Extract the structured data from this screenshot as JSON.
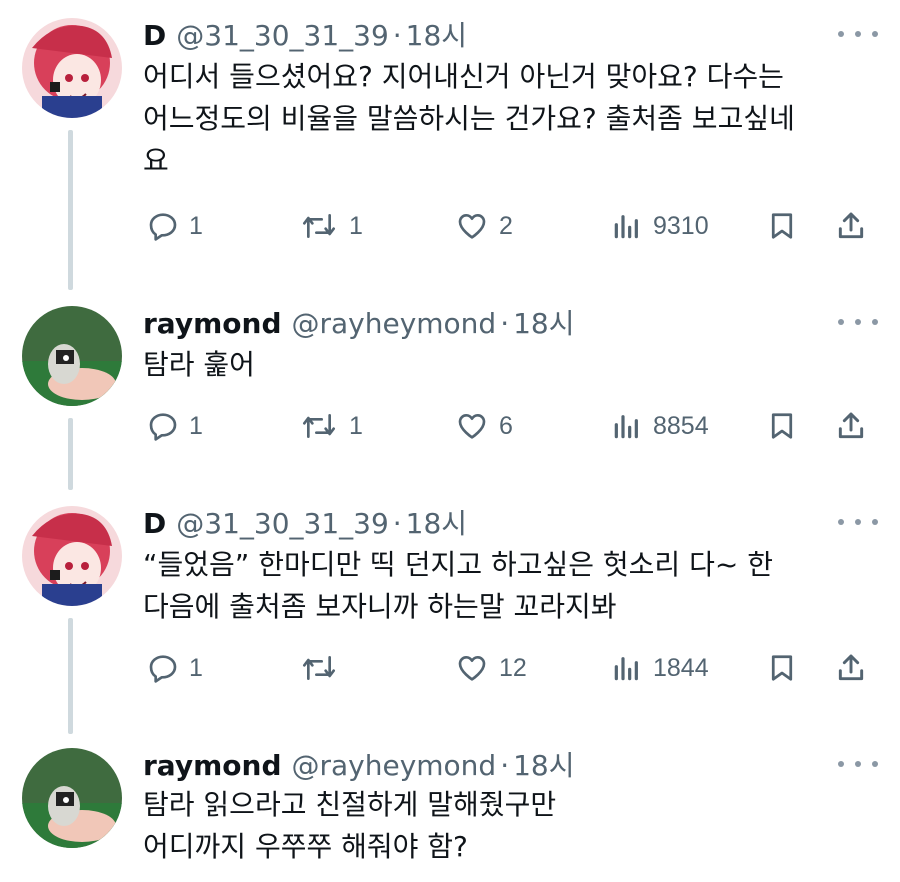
{
  "colors": {
    "text": "#0f1419",
    "secondary": "#536471",
    "thread_line": "#cfd9de"
  },
  "tweets": [
    {
      "name": "D",
      "handle": "@31_30_31_39",
      "separator": "·",
      "time": "18시",
      "lines": [
        "어디서 들으셨어요? 지어내신거 아닌거 맞아요? 다수는",
        "어느정도의 비율을 말씀하시는 건가요? 출처좀 보고싶네",
        "요"
      ],
      "replies": "1",
      "retweets": "1",
      "likes": "2",
      "views": "9310"
    },
    {
      "name": "raymond",
      "handle": "@rayheymond",
      "separator": "·",
      "time": "18시",
      "lines": [
        "탐라 훑어"
      ],
      "replies": "1",
      "retweets": "1",
      "likes": "6",
      "views": "8854"
    },
    {
      "name": "D",
      "handle": "@31_30_31_39",
      "separator": "·",
      "time": "18시",
      "lines": [
        "“들었음” 한마디만 띡 던지고 하고싶은 헛소리 다~ 한",
        "다음에 출처좀 보자니까 하는말 꼬라지봐"
      ],
      "replies": "1",
      "retweets": "",
      "likes": "12",
      "views": "1844"
    },
    {
      "name": "raymond",
      "handle": "@rayheymond",
      "separator": "·",
      "time": "18시",
      "lines": [
        "탐라 읽으라고 친절하게 말해줬구만",
        "어디까지 우쭈쭈 해줘야 함?"
      ]
    }
  ]
}
